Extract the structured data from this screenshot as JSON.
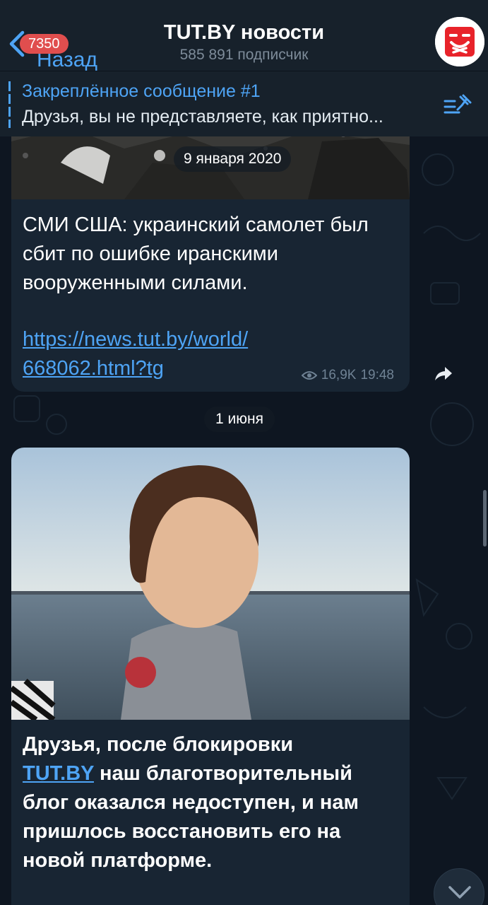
{
  "header": {
    "back_label": "Назад",
    "unread_badge": "7350",
    "title": "TUT.BY новости",
    "subtitle": "585 891 подписчик"
  },
  "pinned": {
    "title": "Закреплённое сообщение #1",
    "text": "Друзья, вы не представляете, как приятно..."
  },
  "messages": [
    {
      "date_label": "9 января 2020",
      "text": "СМИ США: украинский самолет был сбит по ошибке иранскими вооруженными силами.",
      "link_line1": "https://news.tut.by/world/",
      "link_line2": "668062.html?tg",
      "views": "16,9K",
      "time": "19:48"
    },
    {
      "text_link": "TUT.BY",
      "text_line1": "Друзья, после блокировки",
      "text_rest": " наш благотворительный блог оказался недоступен, и нам пришлось восстановить его на новой платформе."
    }
  ],
  "day_separator": "1 июня",
  "colors": {
    "background": "#0e1621",
    "header": "#17212b",
    "bubble": "#182533",
    "accent": "#4ea4f5",
    "badge": "#e04e4e"
  }
}
